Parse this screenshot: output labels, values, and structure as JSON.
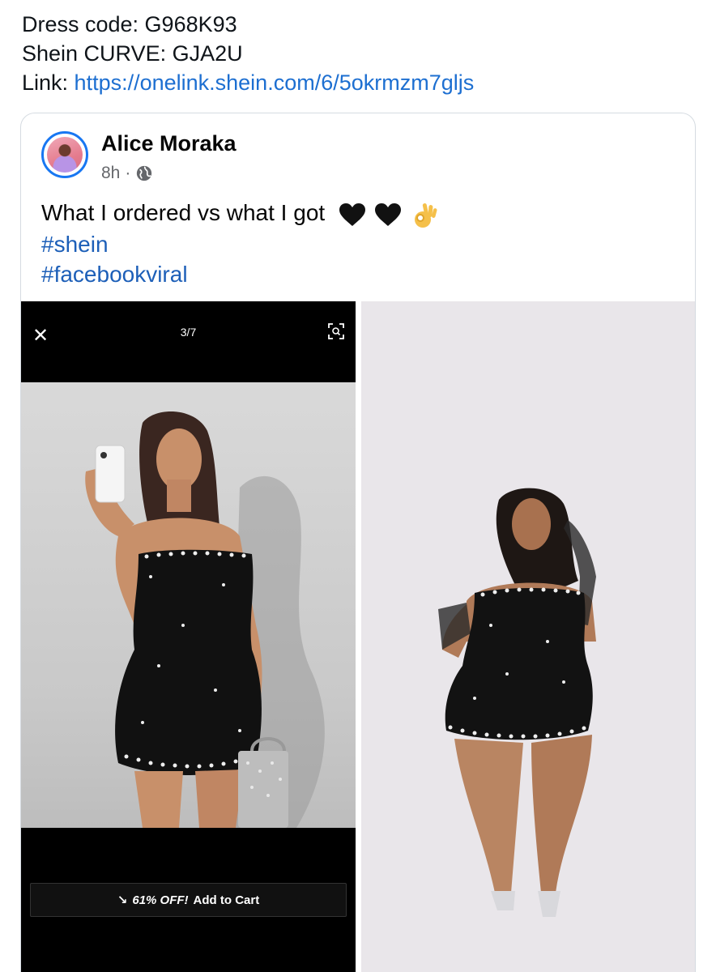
{
  "tweet": {
    "line1": "Dress code: G968K93",
    "line2": "Shein CURVE: GJA2U",
    "link_prefix": "Link: ",
    "link_url": "https://onelink.shein.com/6/5okrmzm7gljs"
  },
  "post": {
    "author": "Alice Moraka",
    "time": "8h",
    "separator": "·",
    "privacy_icon": "globe-icon",
    "text": "What I ordered vs what I got",
    "emojis": [
      "black-heart",
      "black-heart",
      "ok-hand"
    ],
    "hashtags": [
      "#shein",
      "#facebookviral"
    ]
  },
  "screenshot_left": {
    "counter": "3/7",
    "close_icon": "close-icon",
    "scan_icon": "scan-icon",
    "cart_discount": "61% OFF!",
    "cart_label": "Add to Cart"
  },
  "colors": {
    "link": "#1d6fd1",
    "hashtag": "#1d5fb8",
    "avatar_ring": "#1877f2"
  }
}
